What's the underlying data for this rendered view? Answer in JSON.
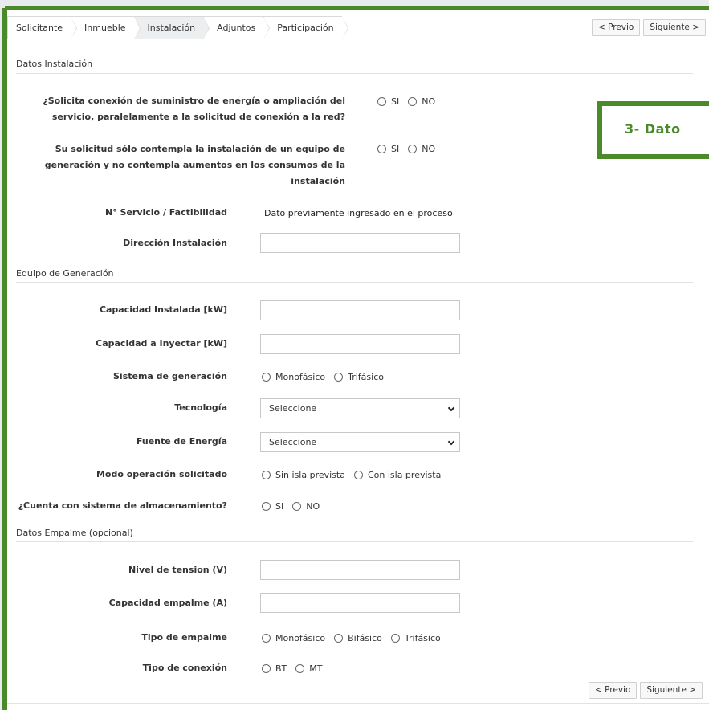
{
  "tabs": [
    {
      "label": "Solicitante",
      "active": false
    },
    {
      "label": "Inmueble",
      "active": false
    },
    {
      "label": "Instalación",
      "active": true
    },
    {
      "label": "Adjuntos",
      "active": false
    },
    {
      "label": "Participación",
      "active": false
    }
  ],
  "nav": {
    "prev_label": "< Previo",
    "next_label": "Siguiente >"
  },
  "callout": {
    "text": "3- Dato"
  },
  "sections": {
    "instalacion": "Datos Instalación",
    "generacion": "Equipo de Generación",
    "empalme": "Datos Empalme (opcional)"
  },
  "q1": {
    "label_line1": "¿Solicita conexión de suministro de energía o ampliación del",
    "label_line2": "servicio, paralelamente a la solicitud de conexión a la red?",
    "options": [
      "SI",
      "NO"
    ]
  },
  "q2": {
    "label_line1": "Su solicitud sólo contempla la instalación de un equipo de",
    "label_line2": "generación y no contempla aumentos en los consumos de la",
    "label_line3": "instalación",
    "options": [
      "SI",
      "NO"
    ]
  },
  "servicio": {
    "label": "N° Servicio / Factibilidad",
    "value": "Dato previamente ingresado en el proceso"
  },
  "direccion": {
    "label": "Dirección Instalación",
    "value": ""
  },
  "cap_instalada": {
    "label": "Capacidad Instalada [kW]",
    "value": ""
  },
  "cap_inyectar": {
    "label": "Capacidad a Inyectar [kW]",
    "value": ""
  },
  "sistema": {
    "label": "Sistema de generación",
    "options": [
      "Monofásico",
      "Trifásico"
    ]
  },
  "tecnologia": {
    "label": "Tecnología",
    "selected": "Seleccione"
  },
  "fuente": {
    "label": "Fuente de Energía",
    "selected": "Seleccione"
  },
  "modo": {
    "label": "Modo operación solicitado",
    "options": [
      "Sin isla prevista",
      "Con isla prevista"
    ]
  },
  "almacenamiento": {
    "label": "¿Cuenta con sistema de almacenamiento?",
    "options": [
      "SI",
      "NO"
    ]
  },
  "nivel_tension": {
    "label": "Nivel de tension (V)",
    "value": ""
  },
  "cap_empalme": {
    "label": "Capacidad empalme (A)",
    "value": ""
  },
  "tipo_empalme": {
    "label": "Tipo de empalme",
    "options": [
      "Monofásico",
      "Bifásico",
      "Trifásico"
    ]
  },
  "tipo_conexion": {
    "label": "Tipo de conexión",
    "options": [
      "BT",
      "MT"
    ]
  },
  "colors": {
    "accent_green": "#4a8a2a",
    "active_tab": "#eceeef"
  }
}
